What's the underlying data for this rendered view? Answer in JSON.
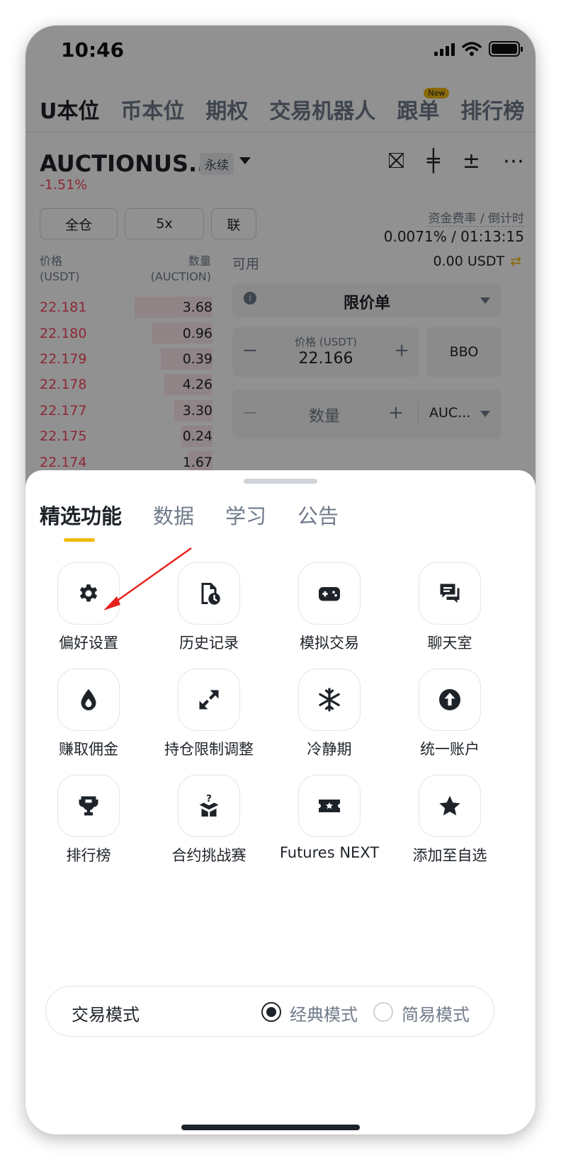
{
  "status": {
    "time": "10:46"
  },
  "top_tabs": [
    {
      "label": "U本位",
      "active": true
    },
    {
      "label": "币本位"
    },
    {
      "label": "期权"
    },
    {
      "label": "交易机器人"
    },
    {
      "label": "跟单",
      "badge": "New"
    },
    {
      "label": "排行榜"
    }
  ],
  "symbol": {
    "name": "AUCTIONUS...",
    "contract_type": "永续",
    "change": "-1.51%"
  },
  "margin_buttons": [
    "全仓",
    "5x",
    "联"
  ],
  "funding": {
    "label": "资金费率 / 倒计时",
    "value": "0.0071% / 01:13:15"
  },
  "orderbook": {
    "price_header": [
      "价格",
      "(USDT)"
    ],
    "qty_header": [
      "数量",
      "(AUCTION)"
    ],
    "rows": [
      {
        "price": "22.181",
        "qty": "3.68",
        "depth": 0.45
      },
      {
        "price": "22.180",
        "qty": "0.96",
        "depth": 0.35
      },
      {
        "price": "22.179",
        "qty": "0.39",
        "depth": 0.3
      },
      {
        "price": "22.178",
        "qty": "4.26",
        "depth": 0.28
      },
      {
        "price": "22.177",
        "qty": "3.30",
        "depth": 0.22
      },
      {
        "price": "22.175",
        "qty": "0.24",
        "depth": 0.18
      },
      {
        "price": "22.174",
        "qty": "1.67",
        "depth": 0.14
      }
    ]
  },
  "order_form": {
    "available_label": "可用",
    "available_value": "0.00 USDT",
    "order_type": "限价单",
    "price_caption": "价格 (USDT)",
    "price_value": "22.166",
    "bbo": "BBO",
    "qty_label": "数量",
    "qty_unit": "AUC..."
  },
  "sheet": {
    "tabs": [
      {
        "label": "精选功能",
        "active": true
      },
      {
        "label": "数据"
      },
      {
        "label": "学习"
      },
      {
        "label": "公告"
      }
    ],
    "features": [
      {
        "label": "偏好设置",
        "icon": "gear-icon"
      },
      {
        "label": "历史记录",
        "icon": "history-doc-icon"
      },
      {
        "label": "模拟交易",
        "icon": "gamepad-icon"
      },
      {
        "label": "聊天室",
        "icon": "chat-icon"
      },
      {
        "label": "赚取佣金",
        "icon": "drop-icon"
      },
      {
        "label": "持仓限制调整",
        "icon": "expand-arrows-icon"
      },
      {
        "label": "冷静期",
        "icon": "snowflake-icon"
      },
      {
        "label": "统一账户",
        "icon": "arrow-up-circle-icon"
      },
      {
        "label": "排行榜",
        "icon": "trophy-icon"
      },
      {
        "label": "合约挑战赛",
        "icon": "mystery-box-icon"
      },
      {
        "label": "Futures NEXT",
        "icon": "ticket-icon"
      },
      {
        "label": "添加至自选",
        "icon": "star-icon"
      }
    ],
    "trade_mode": {
      "label": "交易模式",
      "options": [
        {
          "label": "经典模式",
          "selected": true
        },
        {
          "label": "简易模式",
          "selected": false
        }
      ]
    }
  },
  "colors": {
    "accent": "#f0b90b",
    "sell": "#f6465d",
    "annotation_arrow": "#e8211c"
  }
}
